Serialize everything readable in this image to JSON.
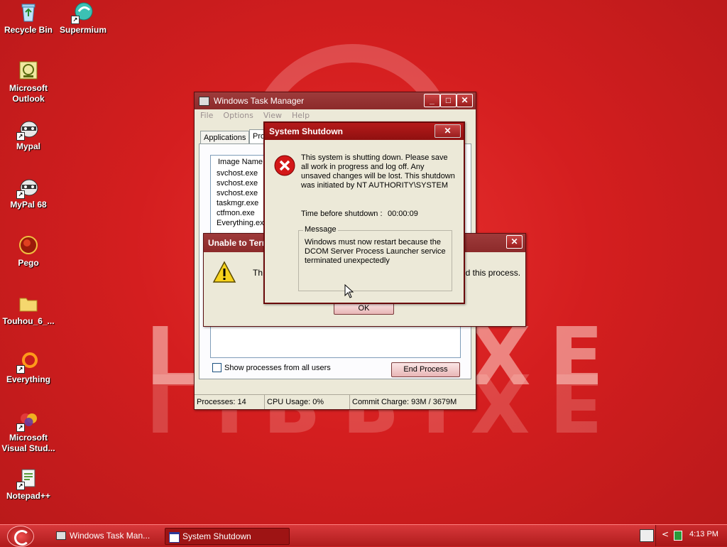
{
  "desktop": {
    "icons": [
      {
        "label": "Recycle Bin",
        "icon": "recycle-bin-icon"
      },
      {
        "label": "Supermium",
        "icon": "supermium-icon"
      },
      {
        "label": "Microsoft Outlook",
        "icon": "outlook-icon"
      },
      {
        "label": "Mypal",
        "icon": "mypal-icon"
      },
      {
        "label": "MyPal 68",
        "icon": "mypal68-icon"
      },
      {
        "label": "Pego",
        "icon": "pego-icon"
      },
      {
        "label": "Touhou_6_...",
        "icon": "folder-icon"
      },
      {
        "label": "Everything",
        "icon": "everything-icon"
      },
      {
        "label": "Microsoft Visual Stud...",
        "icon": "visual-studio-icon"
      },
      {
        "label": "Notepad++",
        "icon": "notepadpp-icon"
      }
    ]
  },
  "task_manager": {
    "title": "Windows Task Manager",
    "menu": [
      "File",
      "Options",
      "View",
      "Help"
    ],
    "tabs": [
      "Applications",
      "Pro"
    ],
    "column_header": "Image Name",
    "processes": [
      "svchost.exe",
      "svchost.exe",
      "svchost.exe",
      "taskmgr.exe",
      "ctfmon.exe",
      "Everything.ex"
    ],
    "show_all_users_label": "Show processes from all users",
    "end_process_label": "End Process",
    "status": {
      "processes": "Processes: 14",
      "cpu": "CPU Usage: 0%",
      "commit": "Commit Charge: 93M / 3679M"
    }
  },
  "unable_dialog": {
    "title": "Unable to Term",
    "message_start": "Th",
    "message_end": "nd this process.",
    "ok_label": "OK"
  },
  "shutdown_dialog": {
    "title": "System Shutdown",
    "message": "This system is shutting down. Please save all work in progress and log off. Any unsaved changes will be lost. This shutdown was initiated by NT AUTHORITY\\SYSTEM",
    "time_label": "Time before shutdown :",
    "time_value": "00:00:09",
    "group_label": "Message",
    "group_text": "Windows must now restart because the DCOM Server Process Launcher service terminated unexpectedly"
  },
  "taskbar": {
    "items": [
      "Windows Task Man...",
      "System Shutdown"
    ],
    "clock": "4:13 PM"
  },
  "wallpaper": {
    "text": "LIBRIXE"
  },
  "colors": {
    "desktop_red": "#d41e1f",
    "titlebar_red": "#8f1010",
    "dialog_face": "#ece9d8",
    "error_red": "#d31818",
    "warning_yellow": "#f7d21c"
  }
}
